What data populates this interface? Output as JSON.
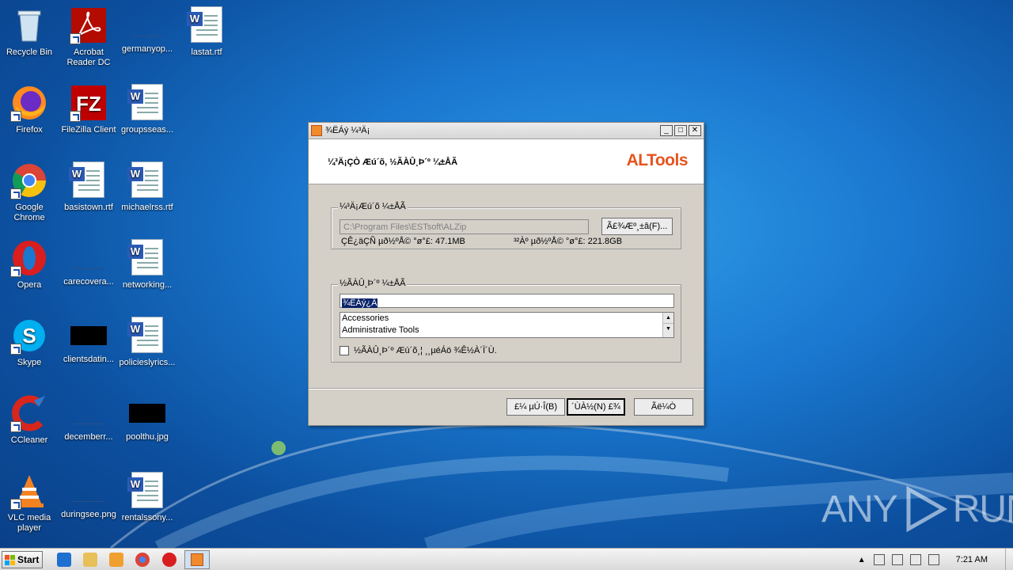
{
  "desktop": {
    "icons": [
      {
        "label": "Recycle Bin",
        "icon": "recycle-bin-icon"
      },
      {
        "label": "Acrobat Reader DC",
        "icon": "acrobat-icon"
      },
      {
        "label": "germanyop...",
        "icon": "blank-file-icon"
      },
      {
        "label": "lastat.rtf",
        "icon": "word-doc-icon"
      },
      {
        "label": "Firefox",
        "icon": "firefox-icon"
      },
      {
        "label": "FileZilla Client",
        "icon": "filezilla-icon"
      },
      {
        "label": "groupsseas...",
        "icon": "word-doc-icon"
      },
      {
        "label": "Google Chrome",
        "icon": "chrome-icon"
      },
      {
        "label": "basistown.rtf",
        "icon": "word-doc-icon"
      },
      {
        "label": "michaelrss.rtf",
        "icon": "word-doc-icon"
      },
      {
        "label": "Opera",
        "icon": "opera-icon"
      },
      {
        "label": "carecovera...",
        "icon": "blank-file-icon"
      },
      {
        "label": "networking...",
        "icon": "word-doc-icon"
      },
      {
        "label": "Skype",
        "icon": "skype-icon"
      },
      {
        "label": "clientsdatin...",
        "icon": "black-image-icon"
      },
      {
        "label": "policieslyrics...",
        "icon": "word-doc-icon"
      },
      {
        "label": "CCleaner",
        "icon": "ccleaner-icon"
      },
      {
        "label": "decemberr...",
        "icon": "blank-file-icon"
      },
      {
        "label": "poolthu.jpg",
        "icon": "black-image-icon"
      },
      {
        "label": "VLC media player",
        "icon": "vlc-icon"
      },
      {
        "label": "duringsee.png",
        "icon": "blank-file-icon"
      },
      {
        "label": "rentalssony...",
        "icon": "word-doc-icon"
      }
    ]
  },
  "dialog": {
    "title": "¾ËÁý ¼³Ä¡",
    "header_text": "¼³Ä¡ÇÒ Æú´õ, ½ÃÀÛ¸Þ´º ¼±ÅÃ",
    "logo": "ALTools",
    "folder_group": {
      "label": "¼³Ä¡Æú´õ ¼±ÅÃ",
      "path": "C:\\Program Files\\ESTsoft\\ALZip",
      "browse_label": "Ã£¾Æº¸±â(F)...",
      "required_space": "ÇÊ¿äÇÑ µð½ºÅ© °ø°£: 47.1MB",
      "available_space": "³²Àº µð½ºÅ© °ø°£: 221.8GB"
    },
    "menu_group": {
      "label": "½ÃÀÛ¸Þ´º ¼±ÅÃ",
      "name_value": "¾ËÁý¿Â",
      "list_items": [
        "Accessories",
        "Administrative Tools"
      ],
      "checkbox_label": "½ÃÀÛ¸Þ´º Æú´õ¸¦ ¸¸µéÁö ¾Ê½À´Ï´Ù."
    },
    "buttons": {
      "back": "£¼ µÚ·Î(B)",
      "next": "´ÙÀ½(N) £¾",
      "cancel": "Ãë¼Ò"
    }
  },
  "taskbar": {
    "start_label": "Start",
    "clock": "7:21 AM"
  },
  "watermark": {
    "left": "ANY",
    "right": "RUN"
  }
}
